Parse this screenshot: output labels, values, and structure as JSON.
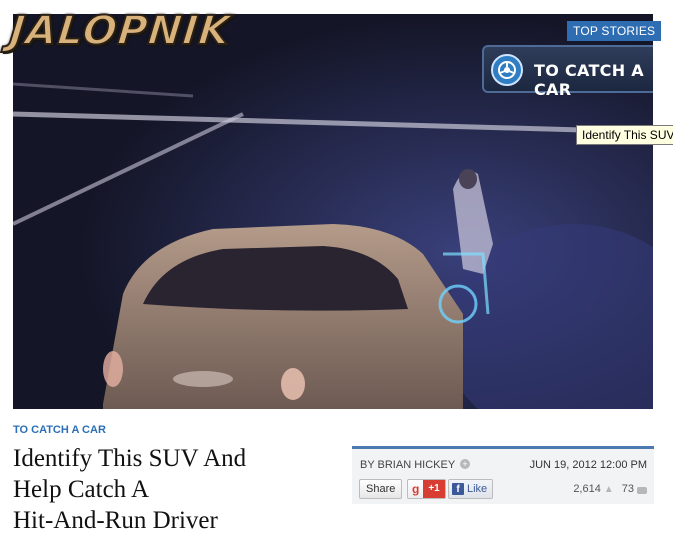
{
  "site": {
    "logo_text": "JALOPNIK"
  },
  "hero": {
    "badge_top_stories": "TOP STORIES",
    "series_label": "TO CATCH A CAR",
    "series_icon": "car-wheel-icon",
    "tooltip": "Identify This SUV"
  },
  "article": {
    "category": "TO CATCH A CAR",
    "headline_lines": [
      "Identify This SUV And",
      "Help Catch A",
      "Hit-And-Run Driver"
    ],
    "author": "BY BRIAN HICKEY",
    "date": "JUN 19, 2012 12:00 PM",
    "share_label": "Share",
    "gplus_g": "g",
    "gplus_label": "+1",
    "fb_f": "f",
    "fb_label": "Like",
    "views": "2,614",
    "comments": "73"
  },
  "colors": {
    "accent_blue": "#2b6fb6",
    "top_stories_bg": "#2f6db3",
    "gplus_red": "#d73d32",
    "facebook_blue": "#3b5998"
  }
}
